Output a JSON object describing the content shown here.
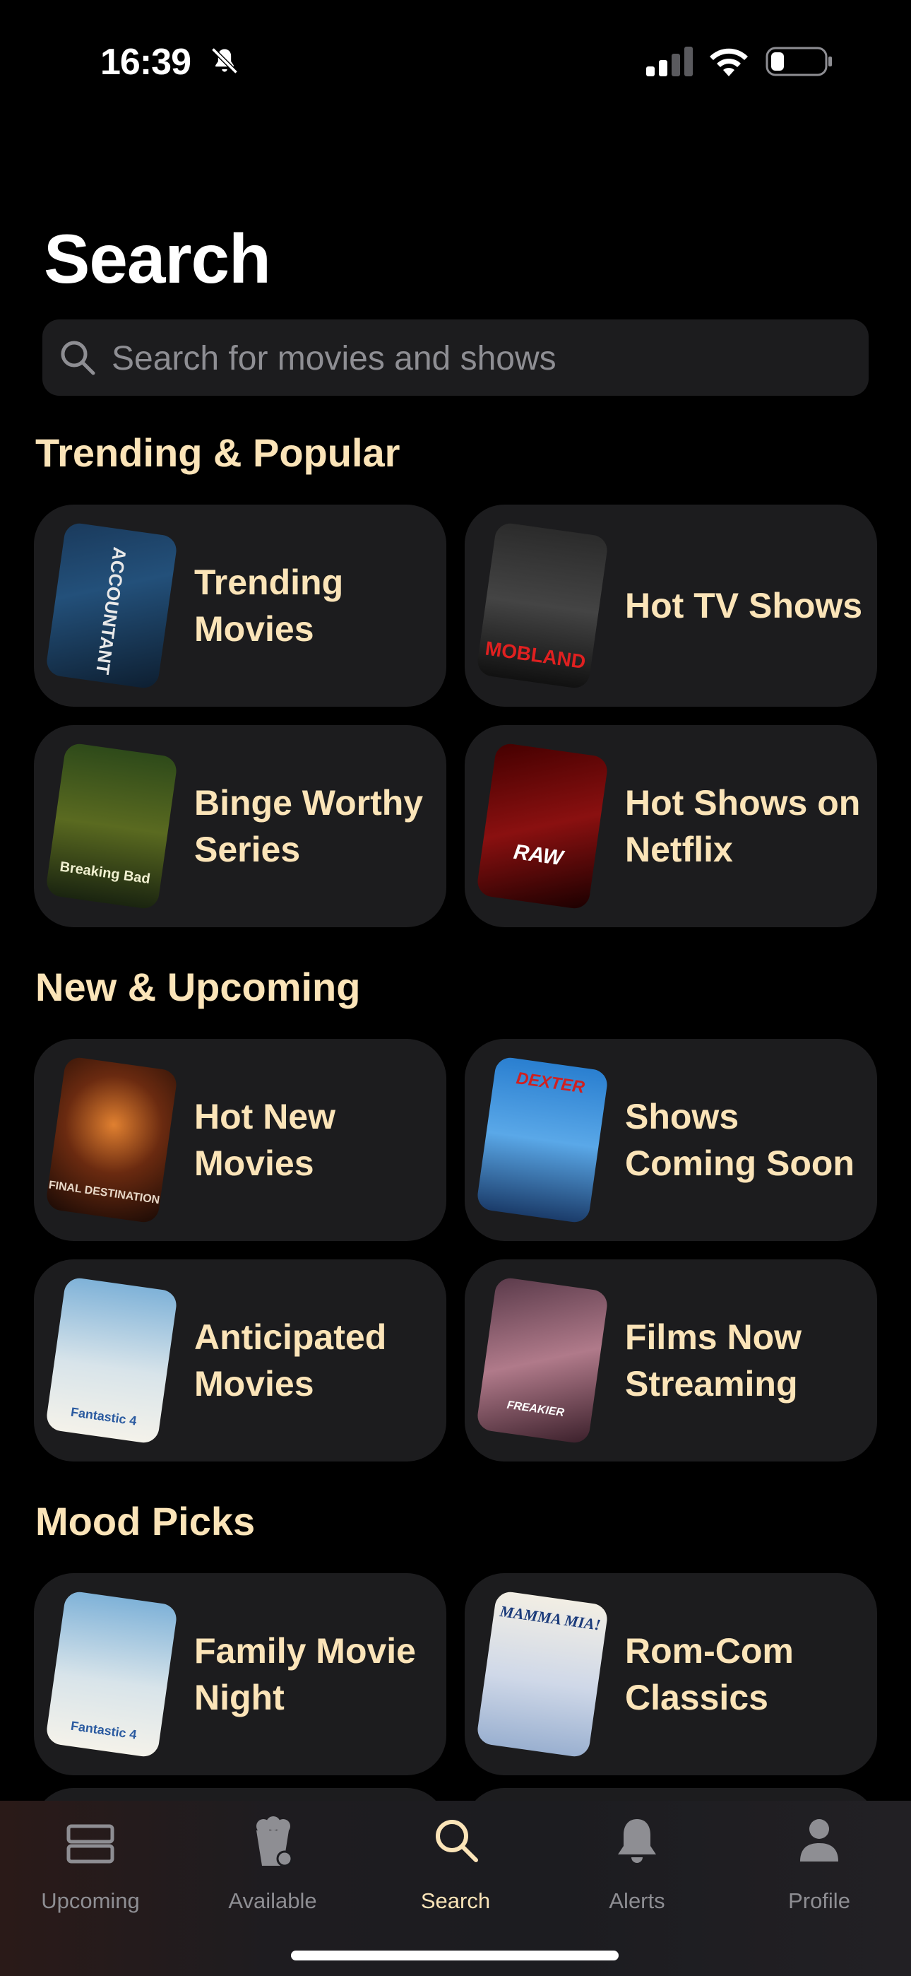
{
  "status_bar": {
    "time": "16:39"
  },
  "header": {
    "title": "Search"
  },
  "search": {
    "placeholder": "Search for movies and shows"
  },
  "sections": [
    {
      "title": "Trending & Popular",
      "cards": [
        {
          "label": "Trending Movies",
          "poster": "The Accountant 2"
        },
        {
          "label": "Hot TV Shows",
          "poster": "MobLand"
        },
        {
          "label": "Binge Worthy Series",
          "poster": "Breaking Bad"
        },
        {
          "label": "Hot Shows on Netflix",
          "poster": "RAW"
        }
      ]
    },
    {
      "title": "New & Upcoming",
      "cards": [
        {
          "label": "Hot New Movies",
          "poster": "Final Destination Bloodlines"
        },
        {
          "label": "Shows Coming Soon",
          "poster": "Dexter Resurrection"
        },
        {
          "label": "Anticipated Movies",
          "poster": "Fantastic 4"
        },
        {
          "label": "Films Now Streaming",
          "poster": "Freakier Friday"
        }
      ]
    },
    {
      "title": "Mood Picks",
      "cards": [
        {
          "label": "Family Movie Night",
          "poster": "Fantastic 4"
        },
        {
          "label": "Rom-Com Classics",
          "poster": "Mamma Mia!"
        }
      ]
    }
  ],
  "tabs": [
    {
      "label": "Upcoming",
      "icon": "upcoming-icon"
    },
    {
      "label": "Available",
      "icon": "popcorn-icon"
    },
    {
      "label": "Search",
      "icon": "search-icon",
      "active": true
    },
    {
      "label": "Alerts",
      "icon": "bell-icon"
    },
    {
      "label": "Profile",
      "icon": "person-icon"
    }
  ],
  "colors": {
    "accent": "#fbe4b8",
    "card": "#1c1c1e",
    "background": "#000000"
  }
}
